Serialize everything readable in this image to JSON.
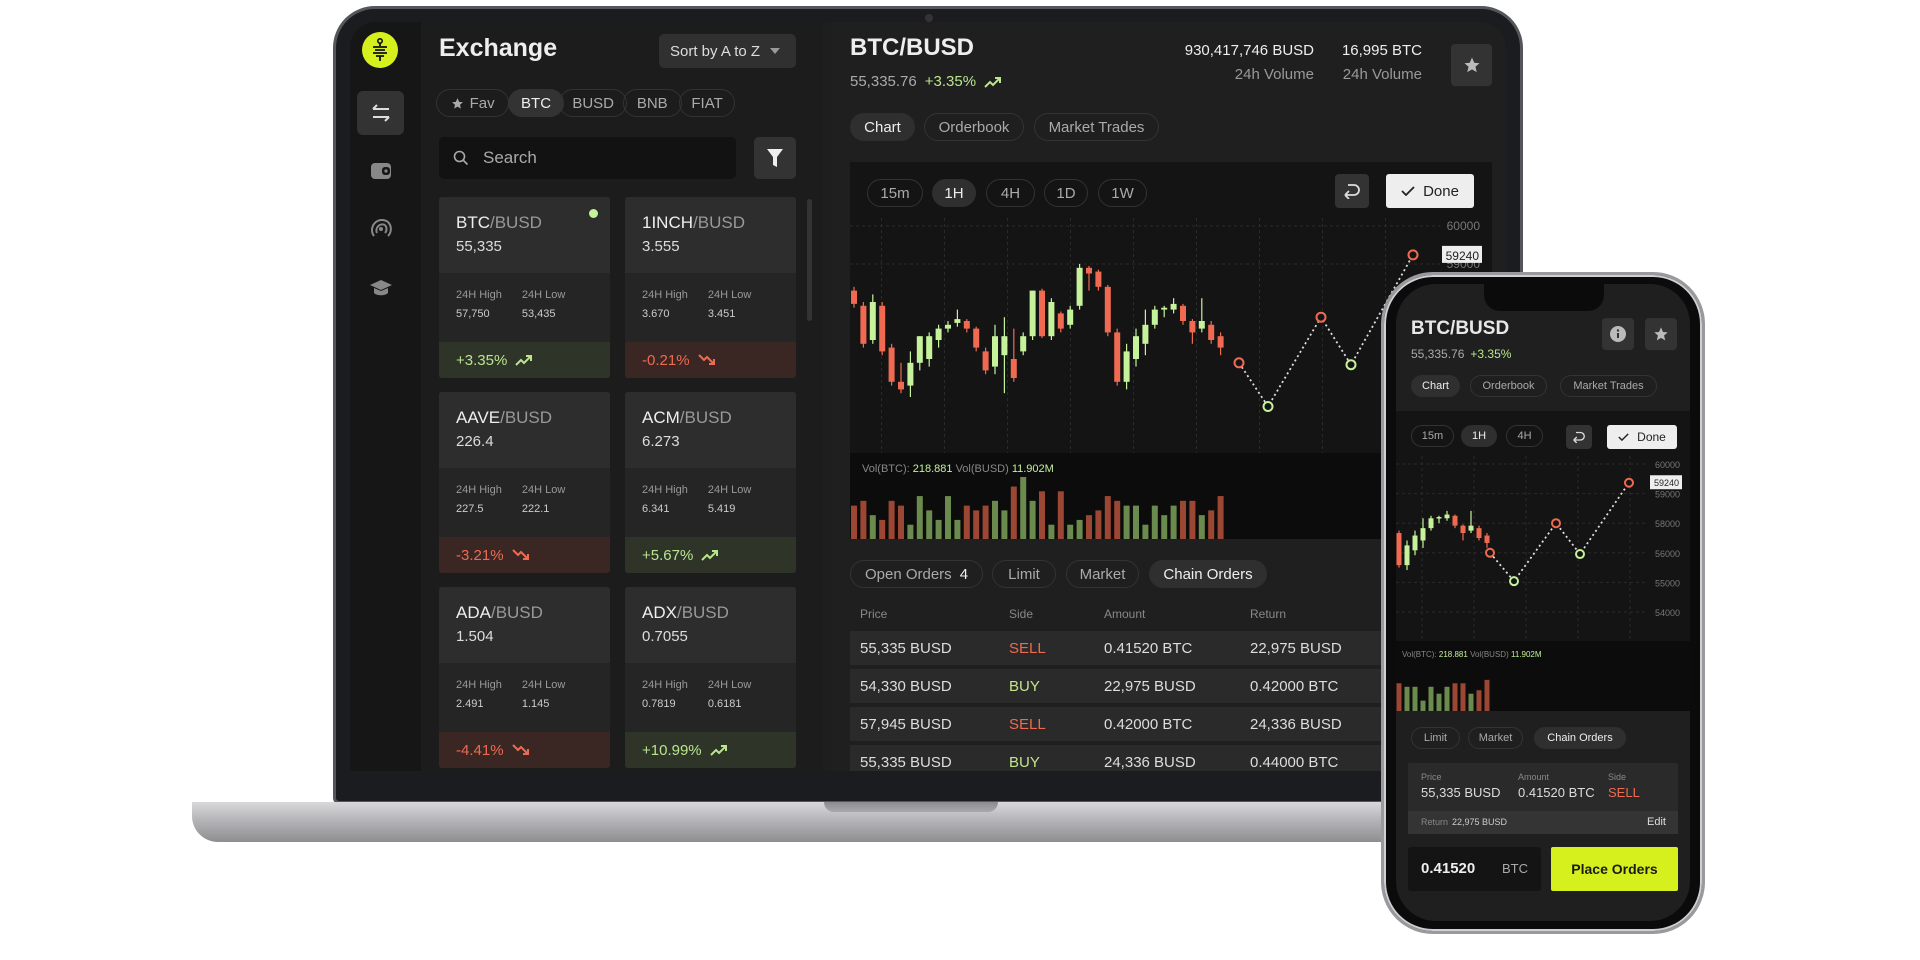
{
  "colors": {
    "accent": "#d6f01e",
    "up": "#c5f29a",
    "down": "#ef6a50",
    "vol_up": "#6b8a4e",
    "vol_down": "#9c4634"
  },
  "laptop": {
    "rail": {
      "icons": [
        "swap-arrows-icon",
        "wallet-icon",
        "signal-icon",
        "graduation-cap-icon"
      ],
      "active": 0
    },
    "list": {
      "title": "Exchange",
      "sort_label": "Sort by A to Z",
      "chips": [
        {
          "label": "Fav",
          "icon": "star-icon"
        },
        {
          "label": "BTC",
          "active": true
        },
        {
          "label": "BUSD"
        },
        {
          "label": "BNB"
        },
        {
          "label": "FIAT"
        }
      ],
      "search_placeholder": "Search",
      "high_label": "24H High",
      "low_label": "24H Low",
      "cards": [
        {
          "base": "BTC",
          "quote": "/BUSD",
          "price": "55,335",
          "high": "57,750",
          "low": "53,435",
          "change": "+3.35%",
          "dir": "up",
          "selected": true
        },
        {
          "base": "1INCH",
          "quote": "/BUSD",
          "price": "3.555",
          "high": "3.670",
          "low": "3.451",
          "change": "-0.21%",
          "dir": "down"
        },
        {
          "base": "AAVE",
          "quote": "/BUSD",
          "price": "226.4",
          "high": "227.5",
          "low": "222.1",
          "change": "-3.21%",
          "dir": "down"
        },
        {
          "base": "ACM",
          "quote": "/BUSD",
          "price": "6.273",
          "high": "6.341",
          "low": "5.419",
          "change": "+5.67%",
          "dir": "up"
        },
        {
          "base": "ADA",
          "quote": "/BUSD",
          "price": "1.504",
          "high": "2.491",
          "low": "1.145",
          "change": "-4.41%",
          "dir": "down"
        },
        {
          "base": "ADX",
          "quote": "/BUSD",
          "price": "0.7055",
          "high": "0.7819",
          "low": "0.6181",
          "change": "+10.99%",
          "dir": "up"
        }
      ]
    },
    "main": {
      "pair": "BTC/BUSD",
      "price": "55,335.76",
      "change": "+3.35%",
      "volumes": [
        {
          "value": "930,417,746 BUSD",
          "label": "24h Volume"
        },
        {
          "value": "16,995 BTC",
          "label": "24h Volume"
        }
      ],
      "tabs": [
        {
          "label": "Chart",
          "active": true
        },
        {
          "label": "Orderbook"
        },
        {
          "label": "Market Trades"
        }
      ],
      "timeframes": [
        {
          "label": "15m"
        },
        {
          "label": "1H",
          "active": true
        },
        {
          "label": "4H"
        },
        {
          "label": "1D"
        },
        {
          "label": "1W"
        }
      ],
      "done_label": "Done",
      "order_tabs": [
        {
          "label": "Open Orders",
          "count": "4"
        },
        {
          "label": "Limit"
        },
        {
          "label": "Market"
        },
        {
          "label": "Chain Orders",
          "active": true
        }
      ],
      "columns": [
        "Price",
        "Side",
        "Amount",
        "Return"
      ],
      "rows": [
        {
          "price": "55,335 BUSD",
          "side": "SELL",
          "amount": "0.41520 BTC",
          "ret": "22,975 BUSD"
        },
        {
          "price": "54,330 BUSD",
          "side": "BUY",
          "amount": "22,975 BUSD",
          "ret": "0.42000 BTC"
        },
        {
          "price": "57,945 BUSD",
          "side": "SELL",
          "amount": "0.42000 BTC",
          "ret": "24,336 BUSD"
        },
        {
          "price": "55,335 BUSD",
          "side": "BUY",
          "amount": "24,336 BUSD",
          "ret": "0.44000 BTC"
        }
      ]
    }
  },
  "phone": {
    "pair": "BTC/BUSD",
    "price": "55,335.76",
    "change": "+3.35%",
    "tabs": [
      {
        "label": "Chart",
        "active": true
      },
      {
        "label": "Orderbook"
      },
      {
        "label": "Market Trades"
      }
    ],
    "timeframes": [
      {
        "label": "15m"
      },
      {
        "label": "1H",
        "active": true
      },
      {
        "label": "4H"
      }
    ],
    "done_label": "Done",
    "yticks": [
      "60000",
      "59000",
      "58000",
      "56000",
      "55000",
      "54000"
    ],
    "order_tabs": [
      {
        "label": "Limit"
      },
      {
        "label": "Market"
      },
      {
        "label": "Chain Orders",
        "active": true
      }
    ],
    "order": {
      "price_label": "Price",
      "price": "55,335 BUSD",
      "amount_label": "Amount",
      "amount": "0.41520 BTC",
      "side_label": "Side",
      "side": "SELL",
      "return_label": "Return",
      "return": "22,975 BUSD",
      "edit_label": "Edit"
    },
    "amount_input": "0.41520",
    "amount_unit": "BTC",
    "place_label": "Place Orders"
  },
  "chart_data": {
    "type": "candlestick",
    "yticks": [
      60000,
      59000
    ],
    "ylim": [
      54000,
      60000
    ],
    "price_tag": "59240",
    "grid": true,
    "volume_label_btc": "Vol(BTC):",
    "volume_btc": "218.881",
    "volume_label_busd": "Vol(BUSD)",
    "volume_busd": "11.902M",
    "candles_ohlc": [
      [
        58300,
        58400,
        57850,
        57950
      ],
      [
        57900,
        58000,
        56800,
        56900
      ],
      [
        57000,
        58200,
        56900,
        58000
      ],
      [
        57900,
        58000,
        56600,
        56700
      ],
      [
        56800,
        56900,
        55800,
        55900
      ],
      [
        55900,
        56400,
        55600,
        55700
      ],
      [
        55800,
        56700,
        55500,
        56400
      ],
      [
        56400,
        57100,
        56200,
        57100
      ],
      [
        56500,
        57200,
        56300,
        57100
      ],
      [
        57000,
        57400,
        56800,
        57300
      ],
      [
        57300,
        57500,
        57200,
        57400
      ],
      [
        57450,
        57800,
        57350,
        57550
      ],
      [
        57500,
        57550,
        57200,
        57300
      ],
      [
        57300,
        57350,
        56700,
        56800
      ],
      [
        56700,
        56800,
        56100,
        56200
      ],
      [
        56300,
        57400,
        56100,
        57100
      ],
      [
        56600,
        57600,
        55600,
        57100
      ],
      [
        56500,
        57300,
        55900,
        56000
      ],
      [
        56700,
        57200,
        56600,
        57100
      ],
      [
        57100,
        58300,
        57000,
        58300
      ],
      [
        58300,
        58350,
        57050,
        57100
      ],
      [
        57100,
        58100,
        57000,
        58000
      ],
      [
        57700,
        57750,
        57200,
        57300
      ],
      [
        57400,
        57900,
        57300,
        57800
      ],
      [
        57900,
        59000,
        57800,
        58900
      ],
      [
        58900,
        58950,
        58300,
        58750
      ],
      [
        58800,
        58850,
        58300,
        58400
      ],
      [
        58400,
        58450,
        57100,
        57200
      ],
      [
        57200,
        57300,
        55800,
        55900
      ],
      [
        55900,
        56900,
        55700,
        56700
      ],
      [
        56500,
        57300,
        56300,
        57100
      ],
      [
        56900,
        57800,
        56600,
        57400
      ],
      [
        57400,
        57900,
        57300,
        57800
      ],
      [
        57800,
        57900,
        57600,
        57850
      ],
      [
        57800,
        58100,
        57700,
        57950
      ],
      [
        57900,
        57950,
        57400,
        57500
      ],
      [
        57500,
        57550,
        56900,
        57200
      ],
      [
        57300,
        58100,
        57200,
        57500
      ],
      [
        57400,
        57500,
        56900,
        57000
      ],
      [
        57100,
        57200,
        56600,
        56800
      ]
    ],
    "volume": [
      7,
      8,
      5,
      4,
      8,
      7,
      3,
      9,
      6,
      4,
      9,
      4,
      7,
      6,
      7,
      8,
      6,
      11,
      13,
      8,
      10,
      3,
      10,
      3,
      4,
      5,
      6,
      9,
      8,
      7,
      7,
      3,
      7,
      5,
      7,
      8,
      8,
      5,
      6,
      9
    ],
    "predicted_orders": [
      {
        "price": 56400,
        "side": "sell"
      },
      {
        "price": 55250,
        "side": "buy"
      },
      {
        "price": 57600,
        "side": "sell"
      },
      {
        "price": 56350,
        "side": "buy"
      },
      {
        "price": 59240,
        "side": "sell"
      }
    ]
  }
}
